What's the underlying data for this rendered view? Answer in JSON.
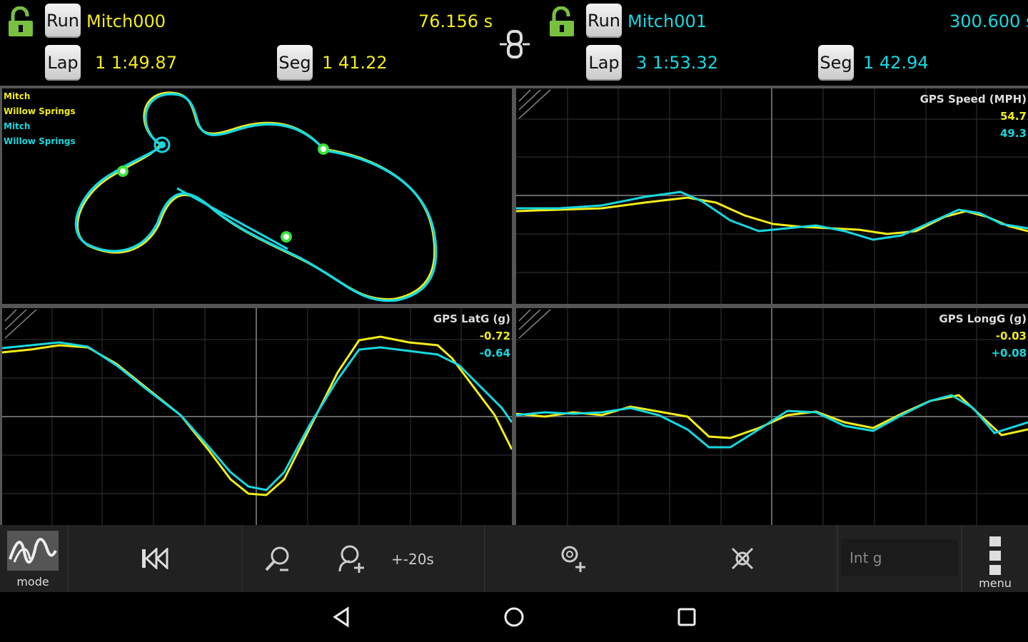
{
  "header": {
    "left": {
      "run_label": "Run",
      "run_name": "Mitch000",
      "time": "76.156 s",
      "lap_label": "Lap",
      "lap_value": "1 1:49.87",
      "seg_label": "Seg",
      "seg_value": "1 41.22"
    },
    "right": {
      "run_label": "Run",
      "run_name": "Mitch001",
      "time": "300.600 s",
      "lap_label": "Lap",
      "lap_value": "3 1:53.32",
      "seg_label": "Seg",
      "seg_value": "1 42.94"
    }
  },
  "map_panel": {
    "legend": [
      {
        "text": "Mitch",
        "color": "#f2ec1a"
      },
      {
        "text": "Willow Springs",
        "color": "#f2ec1a"
      },
      {
        "text": "Mitch",
        "color": "#17d8e0"
      },
      {
        "text": "Willow Springs",
        "color": "#17d8e0"
      }
    ]
  },
  "panels": {
    "speed": {
      "title": "GPS Speed (MPH)",
      "value_a": "54.7",
      "value_b": "49.3"
    },
    "latg": {
      "title": "GPS LatG (g)",
      "value_a": "-0.72",
      "value_b": "-0.64"
    },
    "longg": {
      "title": "GPS LongG (g)",
      "value_a": "-0.03",
      "value_b": "+0.08"
    }
  },
  "toolbar": {
    "mode_label": "mode",
    "zoom_range_label": "+-20s",
    "int_field_placeholder": "Int g",
    "menu_label": "menu"
  },
  "colors": {
    "series_a": "#f2ec1a",
    "series_b": "#17d8e0",
    "grid": "#3a3a3a",
    "toolbar_bg": "#212121"
  },
  "icons": {
    "lock": "unlocked-padlock-icon",
    "link": "chain-link-icon",
    "mode": "mode-graph-icon",
    "skip_back": "skip-to-start-icon",
    "zoom_out": "zoom-out-icon",
    "zoom_in": "zoom-in-icon",
    "marker": "add-marker-icon",
    "clear": "clear-markers-icon",
    "menu": "overflow-menu-icon",
    "back": "nav-back-icon",
    "home": "nav-home-icon",
    "recents": "nav-recents-icon"
  }
}
